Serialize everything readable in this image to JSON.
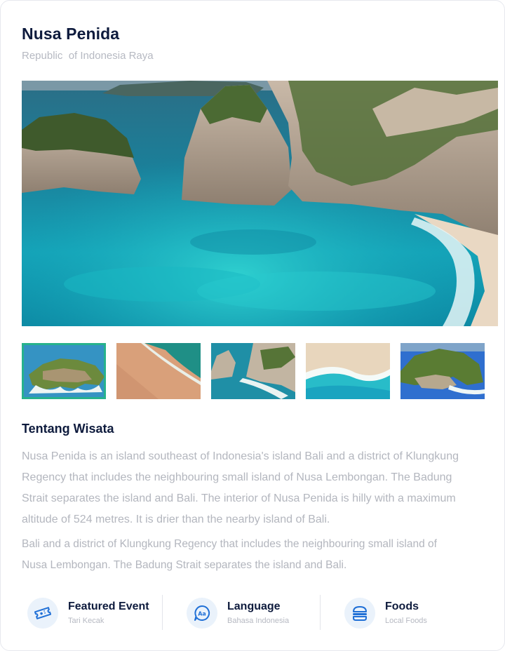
{
  "header": {
    "title": "Nusa Penida",
    "subtitle": "Republic  of Indonesia Raya"
  },
  "gallery": {
    "selected_index": 0,
    "thumbnail_count": 5
  },
  "about": {
    "title": "Tentang Wisata",
    "paragraph1": "Nusa Penida is an island southeast of Indonesia's island Bali and a district of Klungkung Regency that includes the neighbouring small island of Nusa Lembongan. The Badung Strait separates the island and Bali. The interior of Nusa Penida is hilly with a maximum altitude of 524 metres. It is drier than the nearby island of Bali.",
    "paragraph2": "Bali and a district of Klungkung Regency that includes the neighbouring small island of Nusa Lembongan. The Badung Strait separates the island and Bali."
  },
  "features": [
    {
      "icon": "ticket-icon",
      "label": "Featured Event",
      "sub": "Tari Kecak"
    },
    {
      "icon": "language-chat-icon",
      "label": "Language",
      "sub": "Bahasa Indonesia"
    },
    {
      "icon": "burger-food-icon",
      "label": "Foods",
      "sub": "Local Foods"
    }
  ],
  "colors": {
    "accent": "#27b28c",
    "icon_blue": "#1f6fd6",
    "icon_bg": "#eaf2fb",
    "text_dark": "#0e1b3d",
    "text_muted": "#b3b6be"
  }
}
